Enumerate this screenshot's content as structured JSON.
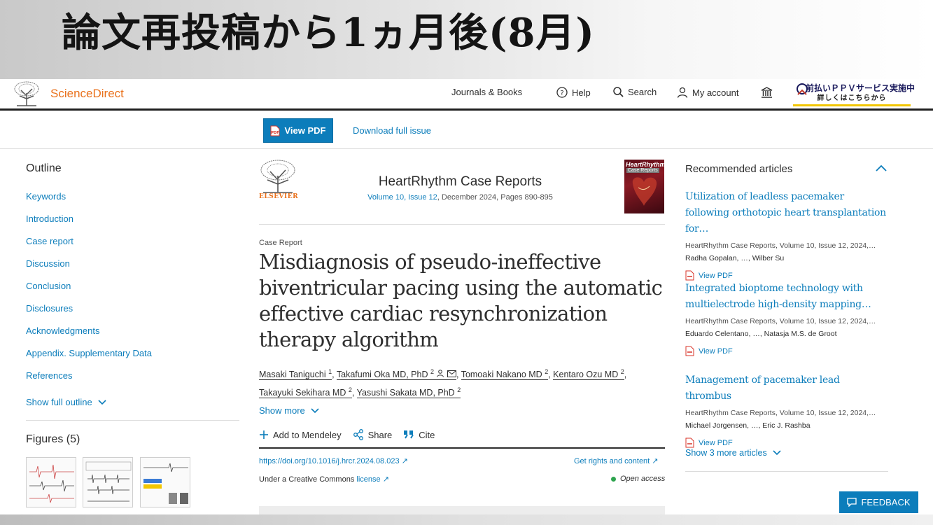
{
  "slide": {
    "title": "論文再投稿から1ヵ月後(8月)"
  },
  "header": {
    "brand": "ScienceDirect",
    "nav": {
      "journals": "Journals & Books",
      "help": "Help",
      "search": "Search",
      "account": "My account"
    },
    "ppv_banner": {
      "line1": "前払いＰＰＶサービス実施中",
      "line2": "詳しくはこちらから"
    }
  },
  "toolbar": {
    "view_pdf": "View PDF",
    "download_issue": "Download full issue"
  },
  "outline": {
    "title": "Outline",
    "items": [
      "Keywords",
      "Introduction",
      "Case report",
      "Discussion",
      "Conclusion",
      "Disclosures",
      "Acknowledgments",
      "Appendix. Supplementary Data",
      "References"
    ],
    "show_full": "Show full outline",
    "figures_title": "Figures (5)"
  },
  "article": {
    "publisher": "ELSEVIER",
    "journal": "HeartRhythm Case Reports",
    "volume_issue": "Volume 10, Issue 12",
    "date_pages": ", December 2024, Pages 890-895",
    "cover_title": "HeartRhythm",
    "cover_subtitle": "Case Reports",
    "type": "Case Report",
    "title": "Misdiagnosis of pseudo-ineffective biventricular pacing using the automatic effective cardiac resynchronization therapy algorithm",
    "authors": [
      {
        "name": "Masaki Taniguchi",
        "sup": "1"
      },
      {
        "name": "Takafumi Oka MD, PhD",
        "sup": "2"
      },
      {
        "name": "Tomoaki Nakano MD",
        "sup": "2"
      },
      {
        "name": "Kentaro Ozu MD",
        "sup": "2"
      },
      {
        "name": "Takayuki Sekihara MD",
        "sup": "2"
      },
      {
        "name": "Yasushi Sakata MD, PhD",
        "sup": "2"
      }
    ],
    "show_more": "Show more",
    "actions": {
      "mendeley": "Add to Mendeley",
      "share": "Share",
      "cite": "Cite"
    },
    "doi": "https://doi.org/10.1016/j.hrcr.2024.08.023",
    "rights": "Get rights and content",
    "license_prefix": "Under a Creative Commons ",
    "license_link": "license",
    "open_access": "Open access"
  },
  "recommended": {
    "title": "Recommended articles",
    "items": [
      {
        "title": "Utilization of leadless pacemaker following orthotopic heart transplantation for…",
        "meta": "HeartRhythm Case Reports, Volume 10, Issue 12, 2024,…",
        "authors": "Radha Gopalan, …, Wilber Su",
        "pdf": "View PDF"
      },
      {
        "title": "Integrated bioptome technology with multielectrode high-density mapping…",
        "meta": "HeartRhythm Case Reports, Volume 10, Issue 12, 2024,…",
        "authors": "Eduardo Celentano, …, Natasja M.S. de Groot",
        "pdf": "View PDF"
      },
      {
        "title": "Management of pacemaker lead thrombus",
        "meta": "HeartRhythm Case Reports, Volume 10, Issue 12, 2024,…",
        "authors": "Michael Jorgensen, …, Eric J. Rashba",
        "pdf": "View PDF"
      }
    ],
    "show_more": "Show 3 more articles"
  },
  "feedback": "FEEDBACK",
  "colors": {
    "link": "#0c7dbb",
    "brand_orange": "#e9711c",
    "banner_accent": "#f2c600"
  }
}
